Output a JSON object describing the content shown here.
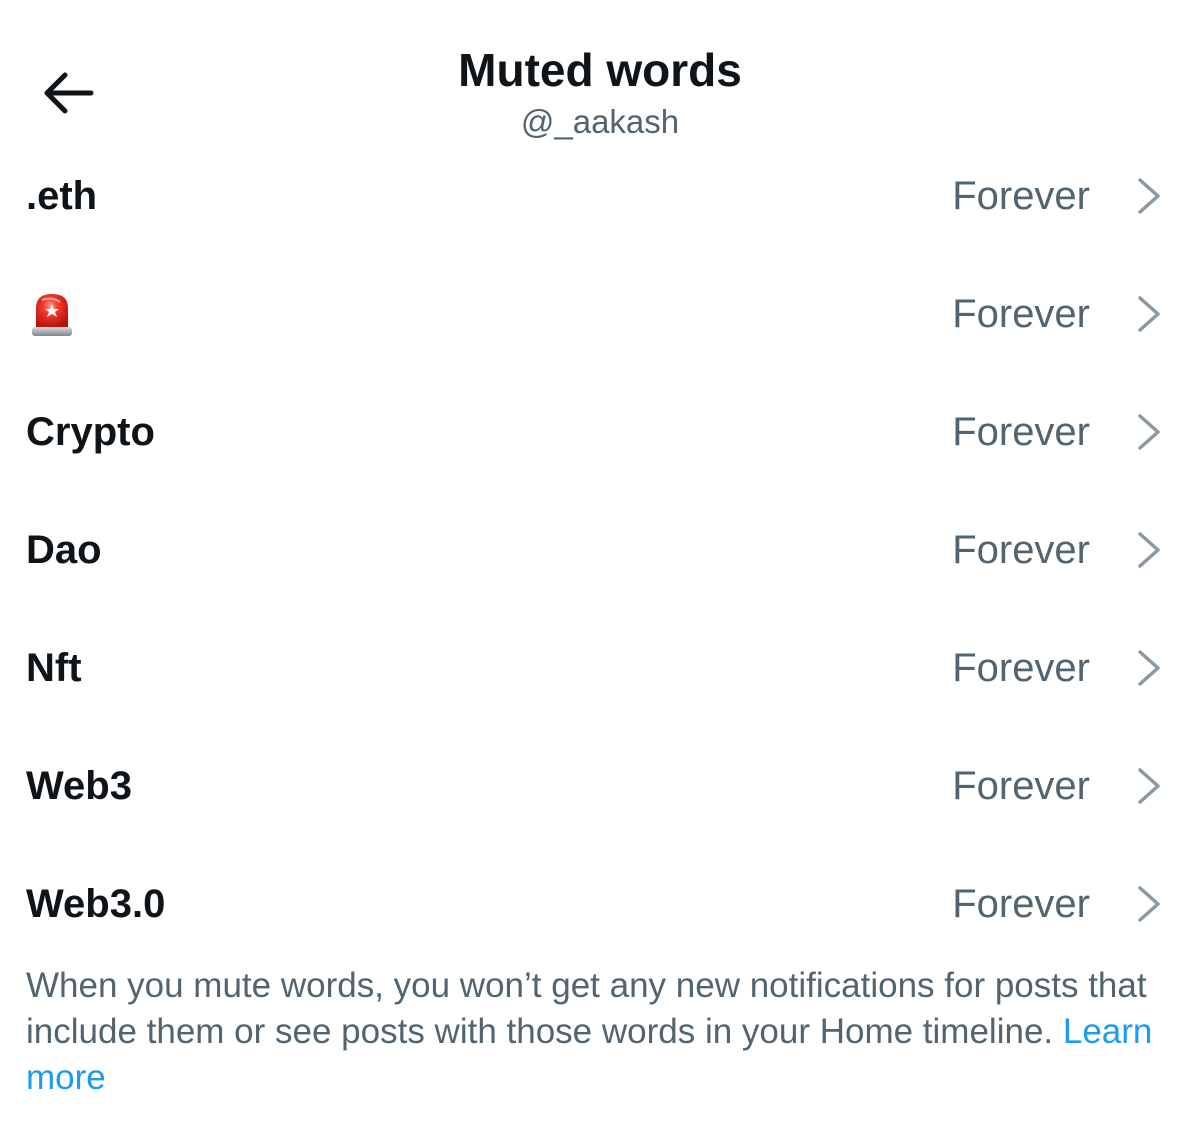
{
  "header": {
    "title": "Muted words",
    "subtitle": "@_aakash",
    "back_icon": "arrow-left-icon"
  },
  "muted_words": [
    {
      "word": ".eth",
      "duration": "Forever"
    },
    {
      "word": "🚨",
      "duration": "Forever",
      "icon": "police-siren-emoji"
    },
    {
      "word": "Crypto",
      "duration": "Forever"
    },
    {
      "word": "Dao",
      "duration": "Forever"
    },
    {
      "word": "Nft",
      "duration": "Forever"
    },
    {
      "word": "Web3",
      "duration": "Forever"
    },
    {
      "word": "Web3.0",
      "duration": "Forever"
    }
  ],
  "footer": {
    "note": "When you mute words, you won’t get any new notifications for posts that include them or see posts with those words in your Home timeline.",
    "link_label": "Learn more"
  },
  "colors": {
    "text_primary": "#0f1419",
    "text_secondary": "#536471",
    "link": "#1d9bf0",
    "chevron": "#8b98a5"
  }
}
